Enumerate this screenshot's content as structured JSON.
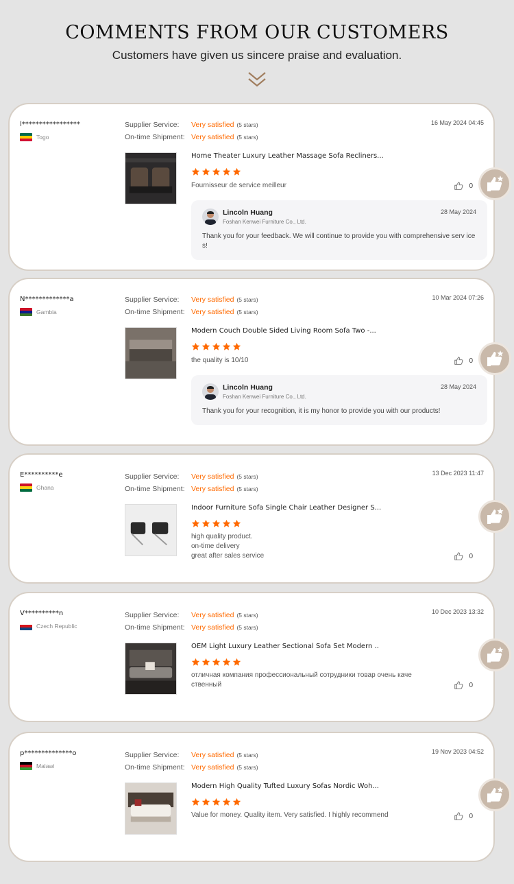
{
  "header": {
    "title": "COMMENTS FROM OUR CUSTOMERS",
    "subtitle": "Customers have given us sincere praise and evaluation."
  },
  "labels": {
    "supplier": "Supplier Service:",
    "shipment": "On-time Shipment:"
  },
  "reviews": [
    {
      "user": "l*****************",
      "country": "Togo",
      "flag_colors": [
        "#006a4e",
        "#ffce00",
        "#d21034"
      ],
      "supplier_rating": "Very satisfied",
      "supplier_stars": "(5 stars)",
      "shipment_rating": "Very satisfied",
      "shipment_stars": "(5 stars)",
      "date": "16 May 2024 04:45",
      "product": "Home Theater Luxury Leather Massage Sofa Recliners...",
      "rating": 5,
      "comment": "Fournisseur de service meilleur",
      "likes": "0",
      "reply": {
        "name": "Lincoln Huang",
        "company": "Foshan Kenwei Furniture Co., Ltd.",
        "date": "28 May 2024",
        "text": "Thank you for your feedback. We will continue to provide you with comprehensive serv ices!"
      }
    },
    {
      "user": "N*************a",
      "country": "Gambia",
      "flag_colors": [
        "#ce1126",
        "#0c1c8c",
        "#3a7728"
      ],
      "supplier_rating": "Very satisfied",
      "supplier_stars": "(5 stars)",
      "shipment_rating": "Very satisfied",
      "shipment_stars": "(5 stars)",
      "date": "10 Mar 2024 07:26",
      "product": "Modern Couch Double Sided Living Room Sofa Two -...",
      "rating": 5,
      "comment": "the quality is 10/10",
      "likes": "0",
      "reply": {
        "name": "Lincoln Huang",
        "company": "Foshan Kenwei Furniture Co., Ltd.",
        "date": "28 May 2024",
        "text": "Thank you for your recognition, it is my honor to provide you with our products!"
      }
    },
    {
      "user": "E**********e",
      "country": "Ghana",
      "flag_colors": [
        "#ce1126",
        "#fcd116",
        "#006b3f"
      ],
      "supplier_rating": "Very satisfied",
      "supplier_stars": "(5 stars)",
      "shipment_rating": "Very satisfied",
      "shipment_stars": "(5 stars)",
      "date": "13 Dec 2023 11:47",
      "product": "Indoor Furniture Sofa Single Chair Leather Designer S...",
      "rating": 5,
      "comment": "high quality product.\non-time delivery\ngreat after sales service",
      "likes": "0"
    },
    {
      "user": "V**********n",
      "country": "Czech Republic",
      "flag_colors": [
        "#ffffff",
        "#d7141a",
        "#11457e"
      ],
      "supplier_rating": "Very satisfied",
      "supplier_stars": "(5 stars)",
      "shipment_rating": "Very satisfied",
      "shipment_stars": "(5 stars)",
      "date": "10 Dec 2023 13:32",
      "product": "OEM Light Luxury Leather Sectional Sofa Set Modern ..",
      "rating": 5,
      "comment": "отличная компания профессиональный сотрудники товар очень каче ственный",
      "likes": "0"
    },
    {
      "user": "p**************o",
      "country": "Malawi",
      "flag_colors": [
        "#000000",
        "#ce1126",
        "#339e35"
      ],
      "supplier_rating": "Very satisfied",
      "supplier_stars": "(5 stars)",
      "shipment_rating": "Very satisfied",
      "shipment_stars": "(5 stars)",
      "date": "19 Nov 2023 04:52",
      "product": "Modern High Quality Tufted Luxury Sofas Nordic Woh...",
      "rating": 5,
      "comment": "Value for money. Quality item. Very satisfied. I highly recommend",
      "likes": "0"
    }
  ]
}
